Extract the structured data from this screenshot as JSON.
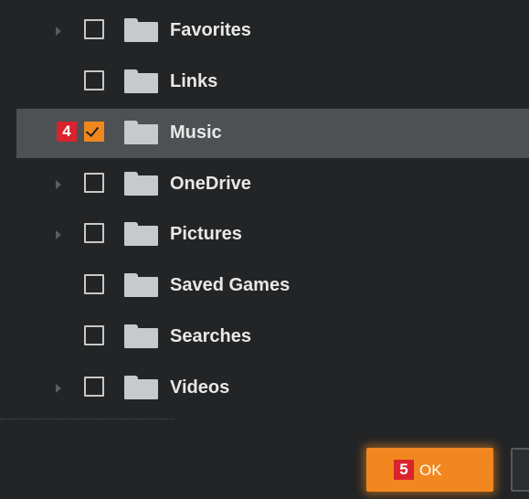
{
  "folders": [
    {
      "label": "Favorites",
      "has_children": true,
      "checked": false,
      "selected": false
    },
    {
      "label": "Links",
      "has_children": false,
      "checked": false,
      "selected": false
    },
    {
      "label": "Music",
      "has_children": false,
      "checked": true,
      "selected": true,
      "step_badge": "4"
    },
    {
      "label": "OneDrive",
      "has_children": true,
      "checked": false,
      "selected": false
    },
    {
      "label": "Pictures",
      "has_children": true,
      "checked": false,
      "selected": false
    },
    {
      "label": "Saved Games",
      "has_children": false,
      "checked": false,
      "selected": false
    },
    {
      "label": "Searches",
      "has_children": false,
      "checked": false,
      "selected": false
    },
    {
      "label": "Videos",
      "has_children": true,
      "checked": false,
      "selected": false
    }
  ],
  "footer": {
    "ok_label": "OK",
    "ok_step_badge": "5"
  },
  "colors": {
    "accent": "#f2871f",
    "badge": "#d9232d",
    "background": "#222426",
    "selected_row": "#4d5154"
  },
  "icons": {
    "folder": "folder-icon",
    "expander": "expand-arrow-icon",
    "check": "checkmark-icon"
  }
}
